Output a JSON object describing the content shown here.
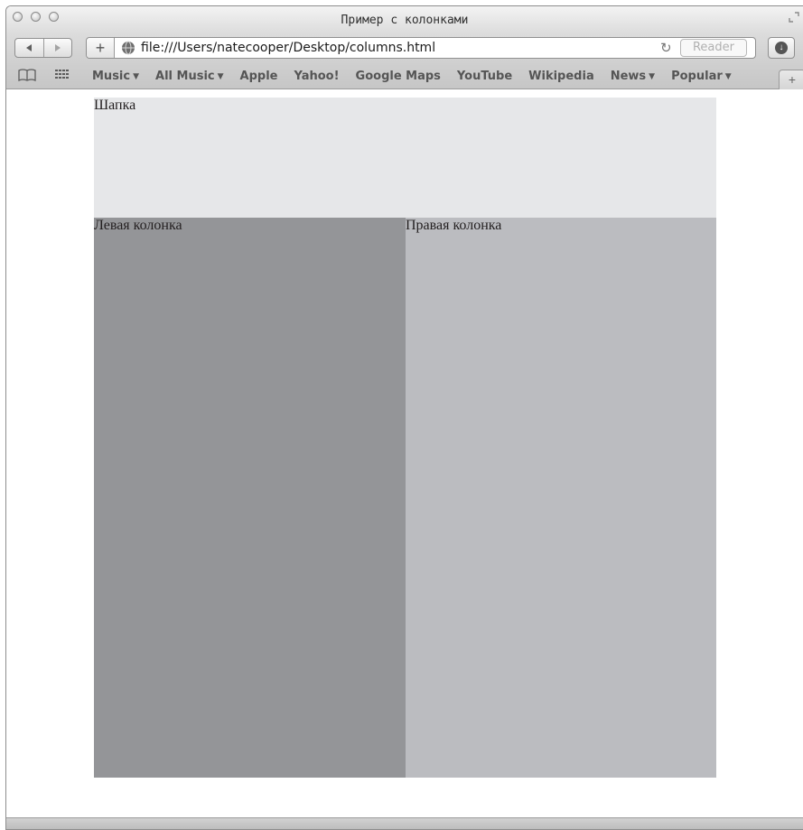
{
  "window": {
    "title": "Пример с колонками"
  },
  "toolbar": {
    "back_icon": "back-arrow-icon",
    "forward_icon": "forward-arrow-icon",
    "add_icon": "plus-icon",
    "url": "file:///Users/natecooper/Desktop/columns.html",
    "reader_label": "Reader"
  },
  "bookmarks": {
    "items": [
      {
        "label": "Music",
        "dropdown": true
      },
      {
        "label": "All Music",
        "dropdown": true
      },
      {
        "label": "Apple",
        "dropdown": false
      },
      {
        "label": "Yahoo!",
        "dropdown": false
      },
      {
        "label": "Google Maps",
        "dropdown": false
      },
      {
        "label": "YouTube",
        "dropdown": false
      },
      {
        "label": "Wikipedia",
        "dropdown": false
      },
      {
        "label": "News",
        "dropdown": true
      },
      {
        "label": "Popular",
        "dropdown": true
      }
    ]
  },
  "page": {
    "header_label": "Шапка",
    "left_column_label": "Левая колонка",
    "right_column_label": "Правая колонка",
    "colors": {
      "header": "#e6e7e9",
      "left_column": "#949598",
      "right_column": "#bbbcc0"
    }
  }
}
